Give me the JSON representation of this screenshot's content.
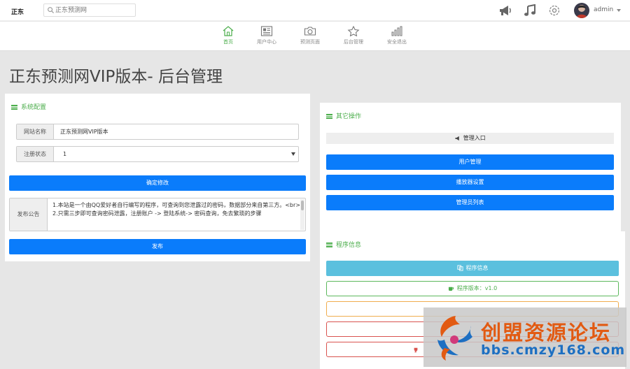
{
  "app": {
    "logo": "正东"
  },
  "search": {
    "placeholder": "正东预测网",
    "value": ""
  },
  "user": {
    "name": "admin"
  },
  "nav": [
    {
      "label": "首页",
      "icon": "home-icon",
      "active": true
    },
    {
      "label": "用户中心",
      "icon": "newspaper-icon",
      "active": false
    },
    {
      "label": "预测页面",
      "icon": "camera-icon",
      "active": false
    },
    {
      "label": "后台管理",
      "icon": "star-icon",
      "active": false
    },
    {
      "label": "安全退出",
      "icon": "bar-chart-icon",
      "active": false
    }
  ],
  "page": {
    "title": "正东预测网VIP版本- 后台管理"
  },
  "config": {
    "heading": "系统配置",
    "site_name_label": "网站名称",
    "site_name_value": "正东预测网VIP版本",
    "reg_label": "注册状态",
    "reg_value": "1",
    "confirm_button": "确定修改",
    "notice_label": "发布公告",
    "notice_text": "1.本站是一个由QQ爱好者自行编写的程序，可查询到您泄露过的密码，数据部分来自第三方。<br>\n2.只需三步即可查询密码泄露，注册账户 -> 登陆系统-> 密码查询，免去繁琐的步骤",
    "publish_button": "发布"
  },
  "other": {
    "heading": "其它操作",
    "entry_label": "管理入口",
    "buttons": [
      "用户管理",
      "播放器设置",
      "管理员列表"
    ]
  },
  "program": {
    "heading": "程序信息",
    "info_button": "程序信息",
    "version_label": "程序版本：v1.0"
  },
  "watermark": {
    "line1": "创盟资源论坛",
    "line2": "bbs.cmzy168.com"
  },
  "colors": {
    "accent": "#4cae4c",
    "primary": "#0a7cfb",
    "info": "#5bc0de"
  }
}
